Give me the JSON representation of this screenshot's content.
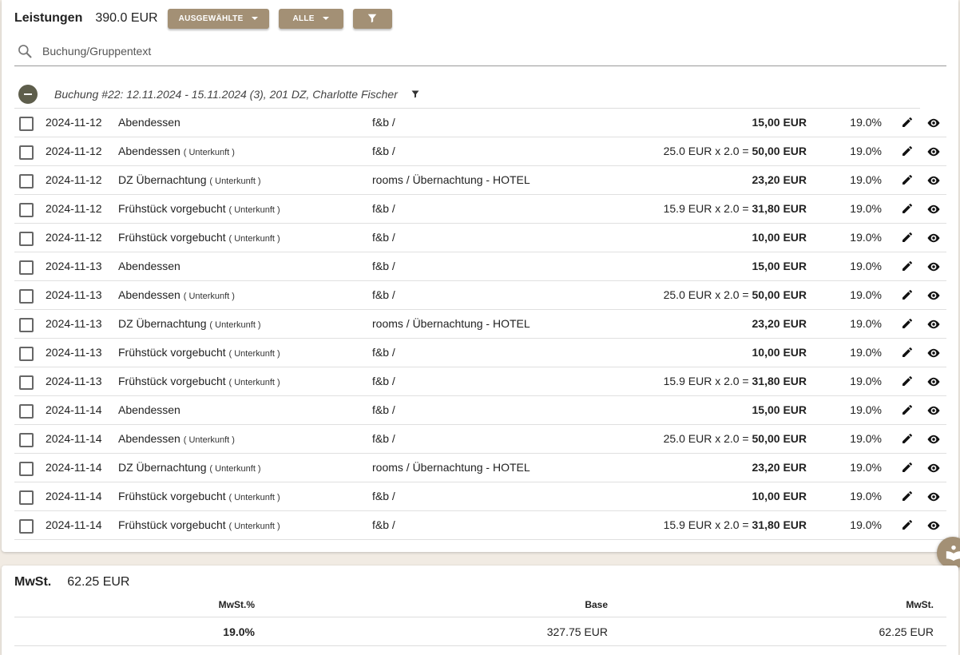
{
  "header": {
    "title": "Leistungen",
    "total": "390.0 EUR",
    "btn_selected": "AUSGEWÄHLTE",
    "btn_all": "ALLE"
  },
  "search": {
    "placeholder": "Buchung/Gruppentext"
  },
  "group": {
    "label": "Buchung #22: 12.11.2024 - 15.11.2024 (3), 201 DZ, Charlotte Fischer"
  },
  "rows": [
    {
      "date": "2024-11-12",
      "name": "Abendessen",
      "tag": "",
      "account": "f&b /",
      "calc": "",
      "amount": "15,00 EUR",
      "vat": "19.0%"
    },
    {
      "date": "2024-11-12",
      "name": "Abendessen",
      "tag": "( Unterkunft )",
      "account": "f&b /",
      "calc": "25.0 EUR x 2.0 = ",
      "amount": "50,00 EUR",
      "vat": "19.0%"
    },
    {
      "date": "2024-11-12",
      "name": "DZ Übernachtung",
      "tag": "( Unterkunft )",
      "account": "rooms / Übernachtung - HOTEL",
      "calc": "",
      "amount": "23,20 EUR",
      "vat": "19.0%"
    },
    {
      "date": "2024-11-12",
      "name": "Frühstück vorgebucht",
      "tag": "( Unterkunft )",
      "account": "f&b /",
      "calc": "15.9 EUR x 2.0 = ",
      "amount": "31,80 EUR",
      "vat": "19.0%"
    },
    {
      "date": "2024-11-12",
      "name": "Frühstück vorgebucht",
      "tag": "( Unterkunft )",
      "account": "f&b /",
      "calc": "",
      "amount": "10,00 EUR",
      "vat": "19.0%"
    },
    {
      "date": "2024-11-13",
      "name": "Abendessen",
      "tag": "",
      "account": "f&b /",
      "calc": "",
      "amount": "15,00 EUR",
      "vat": "19.0%"
    },
    {
      "date": "2024-11-13",
      "name": "Abendessen",
      "tag": "( Unterkunft )",
      "account": "f&b /",
      "calc": "25.0 EUR x 2.0 = ",
      "amount": "50,00 EUR",
      "vat": "19.0%"
    },
    {
      "date": "2024-11-13",
      "name": "DZ Übernachtung",
      "tag": "( Unterkunft )",
      "account": "rooms / Übernachtung - HOTEL",
      "calc": "",
      "amount": "23,20 EUR",
      "vat": "19.0%"
    },
    {
      "date": "2024-11-13",
      "name": "Frühstück vorgebucht",
      "tag": "( Unterkunft )",
      "account": "f&b /",
      "calc": "",
      "amount": "10,00 EUR",
      "vat": "19.0%"
    },
    {
      "date": "2024-11-13",
      "name": "Frühstück vorgebucht",
      "tag": "( Unterkunft )",
      "account": "f&b /",
      "calc": "15.9 EUR x 2.0 = ",
      "amount": "31,80 EUR",
      "vat": "19.0%"
    },
    {
      "date": "2024-11-14",
      "name": "Abendessen",
      "tag": "",
      "account": "f&b /",
      "calc": "",
      "amount": "15,00 EUR",
      "vat": "19.0%"
    },
    {
      "date": "2024-11-14",
      "name": "Abendessen",
      "tag": "( Unterkunft )",
      "account": "f&b /",
      "calc": "25.0 EUR x 2.0 = ",
      "amount": "50,00 EUR",
      "vat": "19.0%"
    },
    {
      "date": "2024-11-14",
      "name": "DZ Übernachtung",
      "tag": "( Unterkunft )",
      "account": "rooms / Übernachtung - HOTEL",
      "calc": "",
      "amount": "23,20 EUR",
      "vat": "19.0%"
    },
    {
      "date": "2024-11-14",
      "name": "Frühstück vorgebucht",
      "tag": "( Unterkunft )",
      "account": "f&b /",
      "calc": "",
      "amount": "10,00 EUR",
      "vat": "19.0%"
    },
    {
      "date": "2024-11-14",
      "name": "Frühstück vorgebucht",
      "tag": "( Unterkunft )",
      "account": "f&b /",
      "calc": "15.9 EUR x 2.0 = ",
      "amount": "31,80 EUR",
      "vat": "19.0%"
    }
  ],
  "vat": {
    "title": "MwSt.",
    "total": "62.25 EUR",
    "columns": [
      "MwSt.%",
      "Base",
      "MwSt."
    ],
    "rows": [
      {
        "rate": "19.0%",
        "base": "327.75 EUR",
        "vat": "62.25 EUR"
      }
    ]
  },
  "colors": {
    "accent": "#a39075",
    "collapse": "#5e5e4c",
    "background": "#f1ebe3"
  },
  "icons": [
    "search-icon",
    "filter-icon",
    "chevron-down-icon",
    "minus-icon",
    "edit-icon",
    "eye-icon",
    "help-book-icon"
  ]
}
